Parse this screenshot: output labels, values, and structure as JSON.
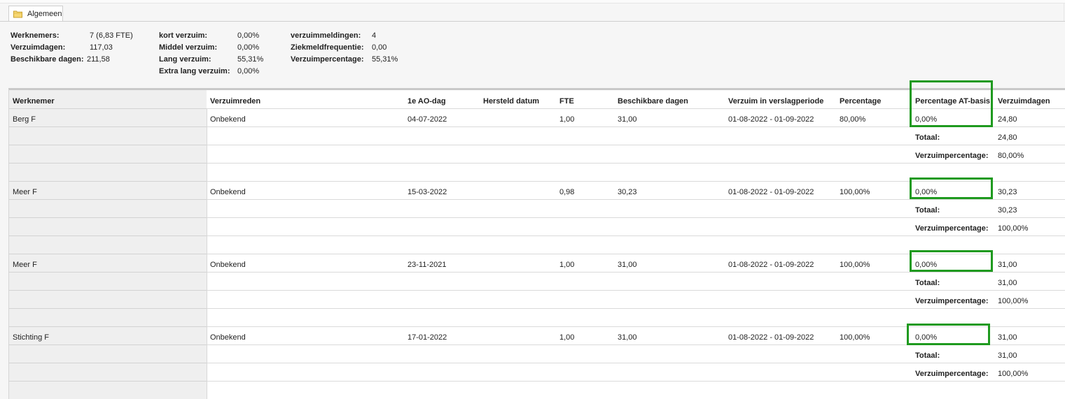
{
  "tab": {
    "label": "Algemeen",
    "icon": "folder-icon"
  },
  "summary": {
    "col1": [
      {
        "label": "Werknemers:",
        "value": "7 (6,83 FTE)"
      },
      {
        "label": "Verzuimdagen:",
        "value": "117,03"
      },
      {
        "label": "Beschikbare dagen:",
        "value": "211,58"
      }
    ],
    "col2": [
      {
        "label": "kort verzuim:",
        "value": "0,00%"
      },
      {
        "label": "Middel verzuim:",
        "value": "0,00%"
      },
      {
        "label": "Lang verzuim:",
        "value": "55,31%"
      },
      {
        "label": "Extra lang verzuim:",
        "value": "0,00%"
      }
    ],
    "col3": [
      {
        "label": "verzuimmeldingen:",
        "value": "4"
      },
      {
        "label": "Ziekmeldfrequentie:",
        "value": "0,00"
      },
      {
        "label": "Verzuimpercentage:",
        "value": "55,31%"
      }
    ]
  },
  "table": {
    "headers": [
      "Werknemer",
      "Verzuimreden",
      "1e AO-dag",
      "Hersteld datum",
      "FTE",
      "Beschikbare dagen",
      "Verzuim in verslagperiode",
      "Percentage",
      "Percentage AT-basis",
      "Verzuimdagen"
    ],
    "total_label": "Totaal:",
    "pct_label": "Verzuimpercentage:",
    "groups": [
      {
        "name": "Berg F",
        "reason": "Onbekend",
        "ao_day": "04-07-2022",
        "recovered": "",
        "fte": "1,00",
        "available": "31,00",
        "period": "01-08-2022 - 01-09-2022",
        "pct": "80,00%",
        "at_pct": "0,00%",
        "days": "24,80",
        "total": "24,80",
        "verzuim_pct": "80,00%"
      },
      {
        "name": "Meer F",
        "reason": "Onbekend",
        "ao_day": "15-03-2022",
        "recovered": "",
        "fte": "0,98",
        "available": "30,23",
        "period": "01-08-2022 - 01-09-2022",
        "pct": "100,00%",
        "at_pct": "0,00%",
        "days": "30,23",
        "total": "30,23",
        "verzuim_pct": "100,00%"
      },
      {
        "name": "Meer F",
        "reason": "Onbekend",
        "ao_day": "23-11-2021",
        "recovered": "",
        "fte": "1,00",
        "available": "31,00",
        "period": "01-08-2022 - 01-09-2022",
        "pct": "100,00%",
        "at_pct": "0,00%",
        "days": "31,00",
        "total": "31,00",
        "verzuim_pct": "100,00%"
      },
      {
        "name": "Stichting F",
        "reason": "Onbekend",
        "ao_day": "17-01-2022",
        "recovered": "",
        "fte": "1,00",
        "available": "31,00",
        "period": "01-08-2022 - 01-09-2022",
        "pct": "100,00%",
        "at_pct": "0,00%",
        "days": "31,00",
        "total": "31,00",
        "verzuim_pct": "100,00%"
      }
    ]
  },
  "colors": {
    "highlight": "#1f9a1f",
    "header_sep": "#c9c9c9"
  }
}
